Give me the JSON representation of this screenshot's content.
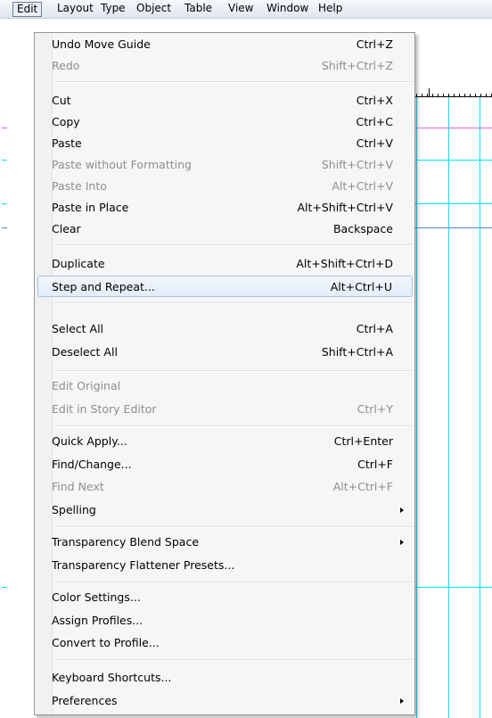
{
  "menubar": {
    "items": [
      "Edit",
      "Layout",
      "Type",
      "Object",
      "Table",
      "View",
      "Window",
      "Help"
    ]
  },
  "menu": {
    "items": [
      {
        "label": "Undo Move Guide",
        "shortcut": "Ctrl+Z",
        "enabled": true
      },
      {
        "label": "Redo",
        "shortcut": "Shift+Ctrl+Z",
        "enabled": false
      },
      {
        "label": "Cut",
        "shortcut": "Ctrl+X",
        "enabled": true
      },
      {
        "label": "Copy",
        "shortcut": "Ctrl+C",
        "enabled": true
      },
      {
        "label": "Paste",
        "shortcut": "Ctrl+V",
        "enabled": true
      },
      {
        "label": "Paste without Formatting",
        "shortcut": "Shift+Ctrl+V",
        "enabled": false
      },
      {
        "label": "Paste Into",
        "shortcut": "Alt+Ctrl+V",
        "enabled": false
      },
      {
        "label": "Paste in Place",
        "shortcut": "Alt+Shift+Ctrl+V",
        "enabled": true
      },
      {
        "label": "Clear",
        "shortcut": "Backspace",
        "enabled": true
      },
      {
        "label": "Duplicate",
        "shortcut": "Alt+Shift+Ctrl+D",
        "enabled": true
      },
      {
        "label": "Step and Repeat...",
        "shortcut": "Alt+Ctrl+U",
        "enabled": true,
        "highlighted": true
      },
      {
        "label": "Select All",
        "shortcut": "Ctrl+A",
        "enabled": true
      },
      {
        "label": "Deselect All",
        "shortcut": "Shift+Ctrl+A",
        "enabled": true
      },
      {
        "label": "Edit Original",
        "shortcut": "",
        "enabled": false
      },
      {
        "label": "Edit in Story Editor",
        "shortcut": "Ctrl+Y",
        "enabled": false
      },
      {
        "label": "Quick Apply...",
        "shortcut": "Ctrl+Enter",
        "enabled": true
      },
      {
        "label": "Find/Change...",
        "shortcut": "Ctrl+F",
        "enabled": true
      },
      {
        "label": "Find Next",
        "shortcut": "Alt+Ctrl+F",
        "enabled": false
      },
      {
        "label": "Spelling",
        "shortcut": "",
        "enabled": true,
        "submenu": true
      },
      {
        "label": "Transparency Blend Space",
        "shortcut": "",
        "enabled": true,
        "submenu": true
      },
      {
        "label": "Transparency Flattener Presets...",
        "shortcut": "",
        "enabled": true
      },
      {
        "label": "Color Settings...",
        "shortcut": "",
        "enabled": true
      },
      {
        "label": "Assign Profiles...",
        "shortcut": "",
        "enabled": true
      },
      {
        "label": "Convert to Profile...",
        "shortcut": "",
        "enabled": true
      },
      {
        "label": "Keyboard Shortcuts...",
        "shortcut": "",
        "enabled": true
      },
      {
        "label": "Preferences",
        "shortcut": "",
        "enabled": true,
        "submenu": true
      }
    ]
  },
  "colors": {
    "guide_cyan": "#00e5ff",
    "guide_magenta": "#e060e0",
    "guide_blue": "#4f7fd0",
    "highlight_border": "#a8c4e6"
  }
}
